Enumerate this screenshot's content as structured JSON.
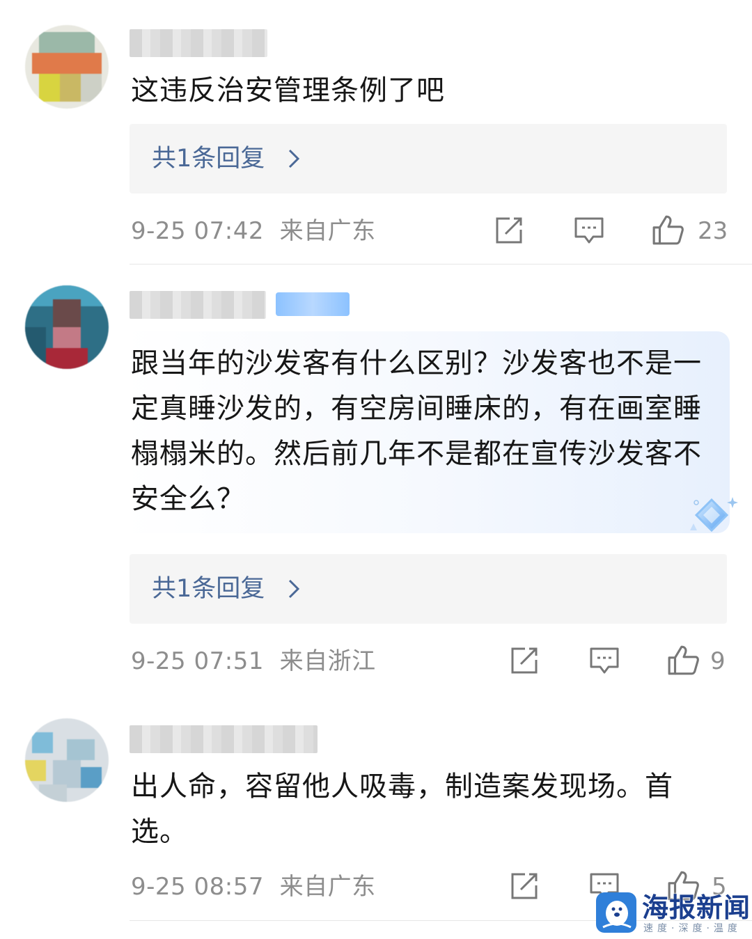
{
  "comments": [
    {
      "text": "这违反治安管理条例了吧",
      "replies_label": "共1条回复",
      "date": "9-25 07:42",
      "location": "来自广东",
      "likes": "23"
    },
    {
      "text": "跟当年的沙发客有什么区别？沙发客也不是一定真睡沙发的，有空房间睡床的，有在画室睡榻榻米的。然后前几年不是都在宣传沙发客不安全么？",
      "replies_label": "共1条回复",
      "date": "9-25 07:51",
      "location": "来自浙江",
      "likes": "9"
    },
    {
      "text": "出人命，容留他人吸毒，制造案发现场。首选。",
      "date": "9-25 08:57",
      "location": "来自广东",
      "likes": "5"
    }
  ],
  "icons": {
    "repost": "share-icon",
    "comment": "comment-icon",
    "like": "thumbs-up-icon",
    "chevron": "chevron-right-icon"
  },
  "colors": {
    "link": "#4a6896",
    "meta": "#8d8d8d",
    "reply_bg": "#f5f5f5",
    "watermark_brand": "#1b3f8f"
  },
  "watermark": {
    "title": "海报新闻",
    "subtitle": "速度·深度·温度"
  }
}
